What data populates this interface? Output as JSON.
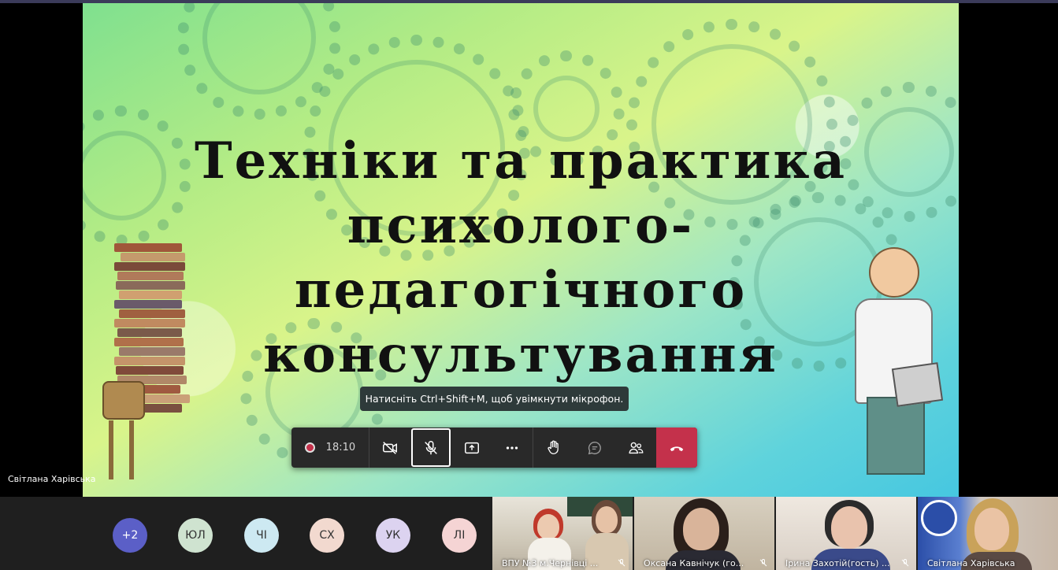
{
  "slide": {
    "title_lines": [
      "Техніки та практика",
      "психолого-",
      "педагогічного",
      "консультування"
    ]
  },
  "tooltip": "Натисніть Ctrl+Shift+M, щоб увімкнути мікрофон.",
  "toolbar": {
    "timer": "18:10",
    "buttons": [
      "record-icon",
      "camera-off-icon",
      "mic-off-icon",
      "share-screen-icon",
      "more-icon",
      "raise-hand-icon",
      "chat-icon",
      "people-icon",
      "hang-up-icon"
    ]
  },
  "presenter_name": "Світлана Харівська",
  "participants": {
    "avatars": [
      {
        "initials": "+2",
        "color": "#5b5fc7"
      },
      {
        "initials": "ЮЛ",
        "color": "#cfe3d0"
      },
      {
        "initials": "ЧІ",
        "color": "#cde9f2"
      },
      {
        "initials": "СХ",
        "color": "#f2d9cf"
      },
      {
        "initials": "УК",
        "color": "#dcd3f0"
      },
      {
        "initials": "ЛІ",
        "color": "#f5d4d4"
      }
    ],
    "video_tiles": [
      {
        "label": "ВПУ №3 м.Чернівці ..."
      },
      {
        "label": "Оксана Кавнічук (го..."
      },
      {
        "label": "Ірина Захотій(гость) ..."
      },
      {
        "label": "Світлана Харівська"
      }
    ]
  },
  "colors": {
    "accent": "#5b5fc7",
    "hangup": "#c4314b",
    "toolbar": "#292929"
  }
}
